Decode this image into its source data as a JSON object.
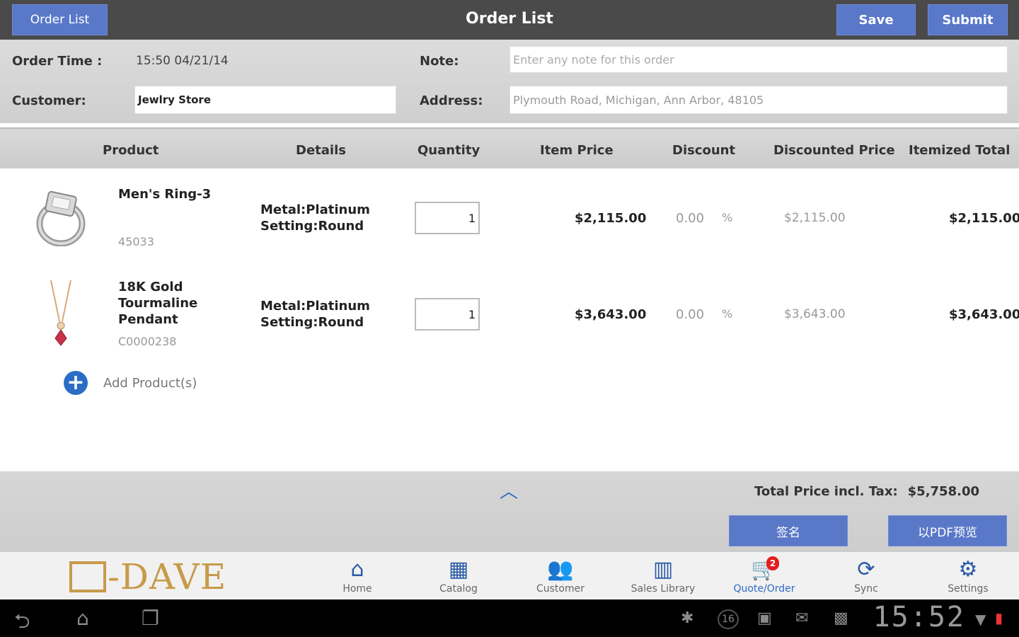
{
  "topbar": {
    "back_label": "Order List",
    "title": "Order List",
    "save_label": "Save",
    "submit_label": "Submit"
  },
  "form": {
    "order_time_label": "Order Time :",
    "order_time_value": "15:50 04/21/14",
    "note_label": "Note:",
    "note_placeholder": "Enter any note for this order",
    "customer_label": "Customer:",
    "customer_value": "Jewlry Store",
    "address_label": "Address:",
    "address_value": "Plymouth Road, Michigan, Ann Arbor, 48105"
  },
  "table": {
    "headers": [
      "Product",
      "Details",
      "Quantity",
      "Item Price",
      "Discount",
      "Discounted Price",
      "Itemized Total"
    ],
    "rows": [
      {
        "name": "Men's Ring-3",
        "sku": "45033",
        "details_line1": "Metal:Platinum",
        "details_line2": "Setting:Round",
        "quantity": "1",
        "item_price": "$2,115.00",
        "discount": "0.00",
        "discount_unit": "%",
        "discounted_price": "$2,115.00",
        "itemized_total": "$2,115.00"
      },
      {
        "name": "18K Gold Tourmaline Pendant",
        "sku": "C0000238",
        "details_line1": "Metal:Platinum",
        "details_line2": "Setting:Round",
        "quantity": "1",
        "item_price": "$3,643.00",
        "discount": "0.00",
        "discount_unit": "%",
        "discounted_price": "$3,643.00",
        "itemized_total": "$3,643.00"
      }
    ],
    "add_products_label": "Add Product(s)"
  },
  "footer": {
    "total_label": "Total Price incl. Tax:",
    "total_value": "$5,758.00",
    "sign_label": "签名",
    "pdf_label": "以PDF预览"
  },
  "nav": {
    "logo": "-DAVE",
    "items": [
      {
        "label": "Home",
        "icon": "home-icon"
      },
      {
        "label": "Catalog",
        "icon": "catalog-icon"
      },
      {
        "label": "Customer",
        "icon": "customer-icon"
      },
      {
        "label": "Sales Library",
        "icon": "library-icon"
      },
      {
        "label": "Quote/Order",
        "icon": "cart-icon",
        "badge": "2"
      },
      {
        "label": "Sync",
        "icon": "sync-icon"
      },
      {
        "label": "Settings",
        "icon": "gear-icon"
      }
    ]
  },
  "system": {
    "clock": "15:52",
    "notification_count": "16"
  },
  "colors": {
    "accent": "#5a78c8",
    "topbar": "#4a4a4a",
    "link_blue": "#2b6cc4",
    "logo_gold": "#c79a4a",
    "badge_red": "#e31e1e"
  }
}
